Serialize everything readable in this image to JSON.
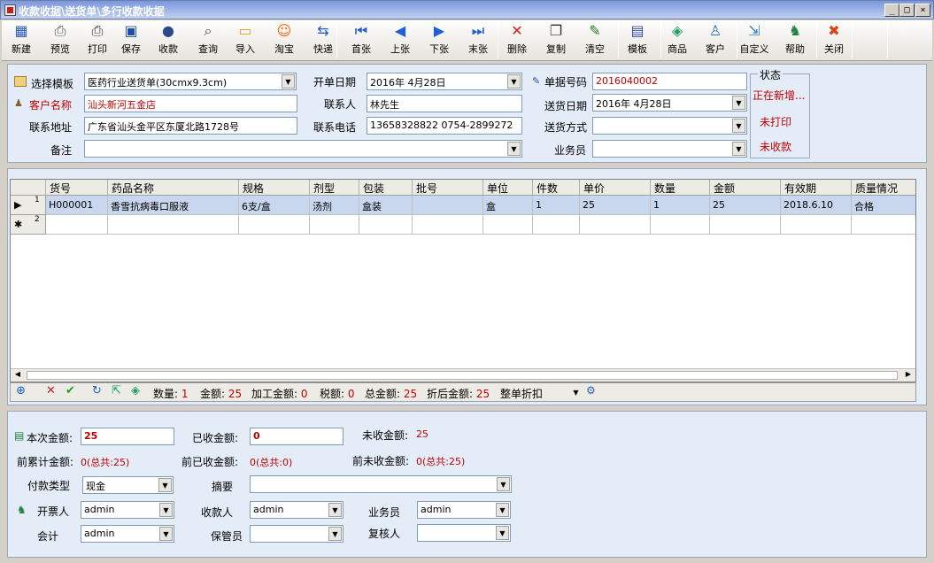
{
  "window": {
    "title": "收款收据\\送货单\\多行收款收据"
  },
  "toolbar": [
    {
      "label": "新建",
      "icon": "▦",
      "color": "#2a5db0"
    },
    {
      "label": "预览",
      "icon": "⎙",
      "color": "#555"
    },
    {
      "label": "打印",
      "icon": "⎙",
      "color": "#333"
    },
    {
      "label": "保存",
      "icon": "▣",
      "color": "#1e4fa0"
    },
    {
      "label": "收款",
      "icon": "●",
      "color": "#2a4a8a"
    },
    {
      "label": "查询",
      "icon": "⌕",
      "color": "#444"
    },
    {
      "label": "导入",
      "icon": "▭",
      "color": "#e0a020"
    },
    {
      "label": "淘宝",
      "icon": "☺",
      "color": "#ff6000"
    },
    {
      "label": "快递",
      "icon": "⇆",
      "color": "#2060c0"
    },
    {
      "label": "首张",
      "icon": "⏮",
      "color": "#2060d0"
    },
    {
      "label": "上张",
      "icon": "◀",
      "color": "#2060d0"
    },
    {
      "label": "下张",
      "icon": "▶",
      "color": "#2060d0"
    },
    {
      "label": "末张",
      "icon": "⏭",
      "color": "#2060d0"
    },
    {
      "label": "删除",
      "icon": "✕",
      "color": "#d02020"
    },
    {
      "label": "复制",
      "icon": "❐",
      "color": "#333"
    },
    {
      "label": "清空",
      "icon": "✎",
      "color": "#208020"
    },
    {
      "label": "模板",
      "icon": "▤",
      "color": "#3050a0"
    },
    {
      "label": "商品",
      "icon": "◈",
      "color": "#20a060"
    },
    {
      "label": "客户",
      "icon": "♙",
      "color": "#3070c0"
    },
    {
      "label": "自定义",
      "icon": "⇲",
      "color": "#3080c0"
    },
    {
      "label": "帮助",
      "icon": "♞",
      "color": "#208040"
    },
    {
      "label": "关闭",
      "icon": "✖",
      "color": "#e04010"
    }
  ],
  "header": {
    "template_label": "选择模板",
    "template_value": "医药行业送货单(30cmx9.3cm)",
    "open_date_label": "开单日期",
    "open_date_value": "2016年 4月28日",
    "doc_no_label": "单据号码",
    "doc_no_value": "2016040002",
    "customer_label": "客户名称",
    "customer_value": "汕头新河五金店",
    "contact_label": "联系人",
    "contact_value": "林先生",
    "delivery_date_label": "送货日期",
    "delivery_date_value": "2016年 4月28日",
    "address_label": "联系地址",
    "address_value": "广东省汕头金平区东厦北路1728号",
    "phone_label": "联系电话",
    "phone_value": "13658328822 0754-2899272",
    "ship_method_label": "送货方式",
    "ship_method_value": "",
    "remark_label": "备注",
    "remark_value": "",
    "salesman_label": "业务员",
    "salesman_value": ""
  },
  "status": {
    "title": "状态",
    "s1": "正在新增...",
    "s2": "未打印",
    "s3": "未收款"
  },
  "grid": {
    "columns": [
      "货号",
      "药品名称",
      "规格",
      "剂型",
      "包装",
      "批号",
      "单位",
      "件数",
      "单价",
      "数量",
      "金额",
      "有效期",
      "质量情况"
    ],
    "rows": [
      {
        "num": "1",
        "cells": [
          "H000001",
          "香雪抗病毒口服液",
          "6支/盒",
          "汤剂",
          "盒装",
          "",
          "盒",
          "1",
          "25",
          "1",
          "25",
          "2018.6.10",
          "合格"
        ]
      },
      {
        "num": "2",
        "cells": [
          "",
          "",
          "",
          "",
          "",
          "",
          "",
          "",
          "",
          "",
          "",
          "",
          ""
        ]
      }
    ]
  },
  "footer": {
    "qty_label": "数量:",
    "qty": "1",
    "amount_label": "金额:",
    "amount": "25",
    "proc_label": "加工金额:",
    "proc": "0",
    "tax_label": "税额:",
    "tax": "0",
    "total_label": "总金额:",
    "total": "25",
    "disc_label": "折后金额:",
    "disc": "25",
    "whole_disc_label": "整单折扣"
  },
  "payment": {
    "this_label": "本次金额:",
    "this_value": "25",
    "received_label": "已收金额:",
    "received_value": "0",
    "unreceived_label": "未收金额:",
    "unreceived_value": "25",
    "acc_label": "前累计金额:",
    "acc_value": "0(总共:25)",
    "prev_recv_label": "前已收金额:",
    "prev_recv_value": "0(总共:0)",
    "prev_unrecv_label": "前未收金额:",
    "prev_unrecv_value": "0(总共:25)",
    "paytype_label": "付款类型",
    "paytype_value": "现金",
    "summary_label": "摘要",
    "summary_value": "",
    "issuer_label": "开票人",
    "issuer_value": "admin",
    "payee_label": "收款人",
    "payee_value": "admin",
    "salesman_label": "业务员",
    "salesman_value": "admin",
    "accountant_label": "会计",
    "accountant_value": "admin",
    "keeper_label": "保管员",
    "keeper_value": "",
    "reviewer_label": "复核人",
    "reviewer_value": ""
  }
}
